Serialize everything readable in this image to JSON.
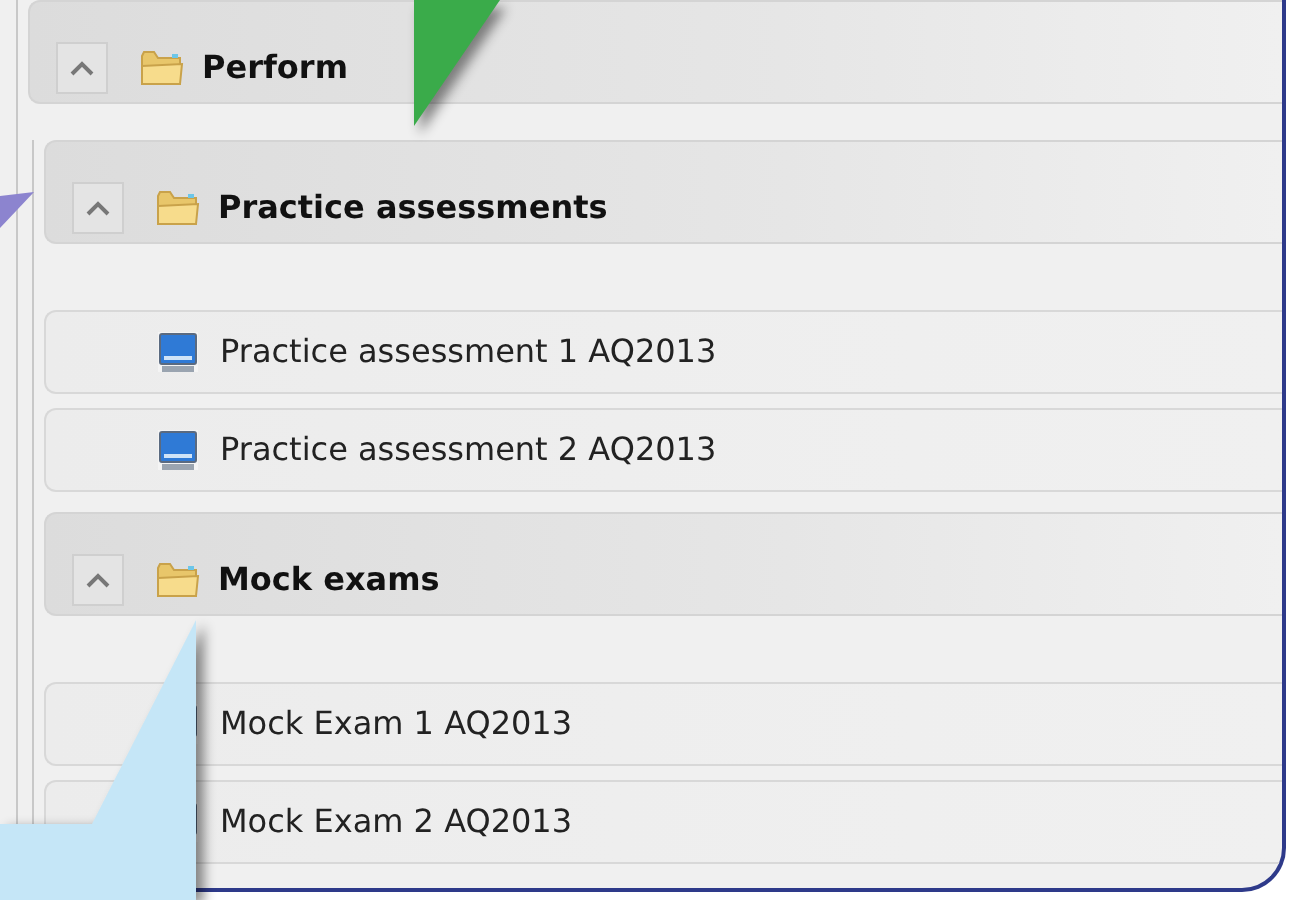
{
  "sections": [
    {
      "title": "Perform",
      "expanded": true,
      "children": [
        {
          "title": "Practice assessments",
          "expanded": true,
          "items": [
            {
              "label": "Practice assessment 1 AQ2013"
            },
            {
              "label": "Practice assessment 2 AQ2013"
            }
          ]
        },
        {
          "title": "Mock exams",
          "expanded": true,
          "items": [
            {
              "label": "Mock Exam 1 AQ2013"
            },
            {
              "label": "Mock Exam 2 AQ2013"
            }
          ]
        }
      ]
    }
  ]
}
